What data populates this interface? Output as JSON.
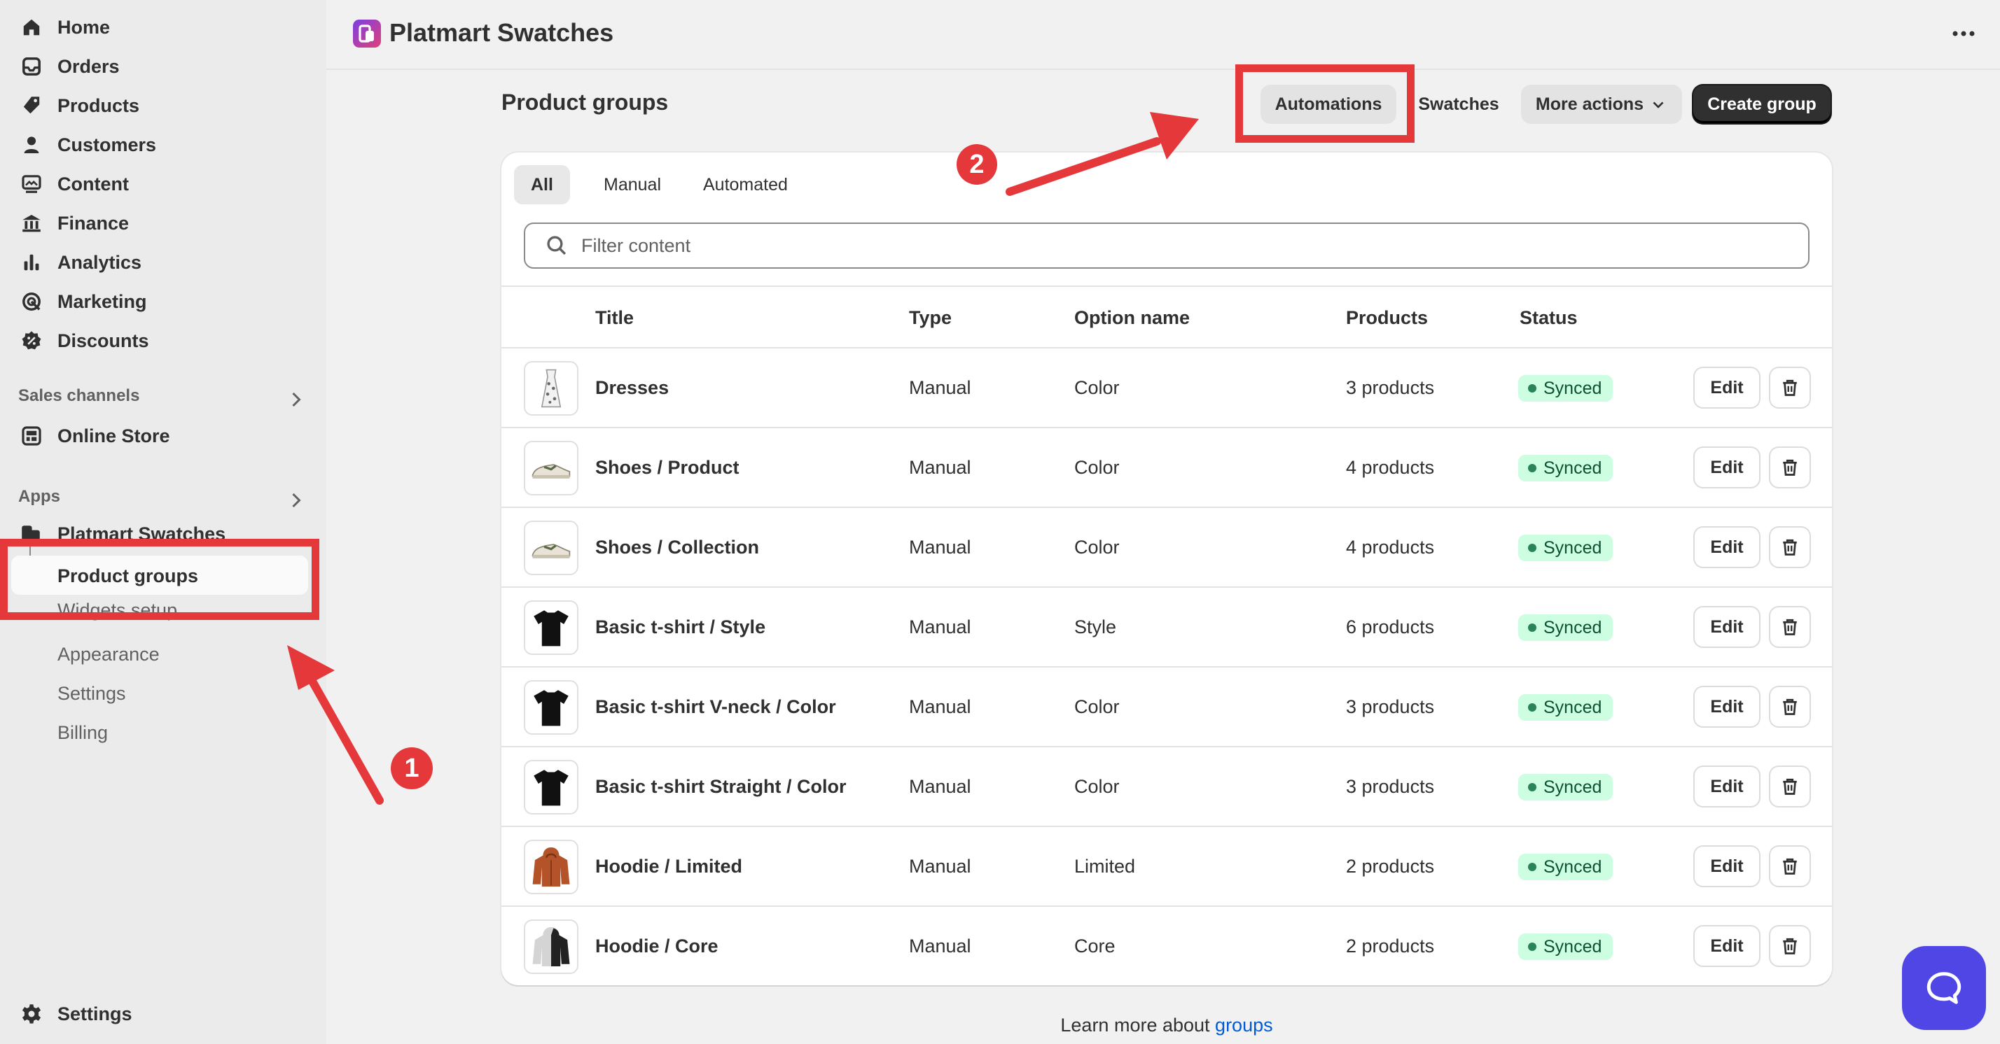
{
  "sidebar": {
    "nav": [
      {
        "label": "Home",
        "icon": "home-icon"
      },
      {
        "label": "Orders",
        "icon": "inbox-icon"
      },
      {
        "label": "Products",
        "icon": "tag-icon"
      },
      {
        "label": "Customers",
        "icon": "person-icon"
      },
      {
        "label": "Content",
        "icon": "image-icon"
      },
      {
        "label": "Finance",
        "icon": "bank-icon"
      },
      {
        "label": "Analytics",
        "icon": "bar-chart-icon"
      },
      {
        "label": "Marketing",
        "icon": "target-icon"
      },
      {
        "label": "Discounts",
        "icon": "discount-icon"
      }
    ],
    "sales_channels_label": "Sales channels",
    "online_store_label": "Online Store",
    "apps_label": "Apps",
    "app_name": "Platmart Swatches",
    "app_subitems": {
      "active": "Product groups",
      "widgets": "Widgets setup",
      "appearance": "Appearance",
      "settings": "Settings",
      "billing": "Billing"
    },
    "settings_label": "Settings"
  },
  "header": {
    "app_title": "Platmart Swatches"
  },
  "page": {
    "title": "Product groups",
    "actions": {
      "automations": "Automations",
      "swatches": "Swatches",
      "more_actions": "More actions",
      "create_group": "Create group"
    },
    "tabs": [
      "All",
      "Manual",
      "Automated"
    ],
    "filter_placeholder": "Filter content",
    "columns": {
      "title": "Title",
      "type": "Type",
      "option_name": "Option name",
      "products": "Products",
      "status": "Status"
    },
    "rows": [
      {
        "title": "Dresses",
        "type": "Manual",
        "option": "Color",
        "products": "3 products",
        "status": "Synced",
        "thumb": "dress"
      },
      {
        "title": "Shoes / Product",
        "type": "Manual",
        "option": "Color",
        "products": "4 products",
        "status": "Synced",
        "thumb": "shoe"
      },
      {
        "title": "Shoes / Collection",
        "type": "Manual",
        "option": "Color",
        "products": "4 products",
        "status": "Synced",
        "thumb": "shoe"
      },
      {
        "title": "Basic t-shirt / Style",
        "type": "Manual",
        "option": "Style",
        "products": "6 products",
        "status": "Synced",
        "thumb": "tshirt"
      },
      {
        "title": "Basic t-shirt V-neck / Color",
        "type": "Manual",
        "option": "Color",
        "products": "3 products",
        "status": "Synced",
        "thumb": "tshirt"
      },
      {
        "title": "Basic t-shirt Straight / Color",
        "type": "Manual",
        "option": "Color",
        "products": "3 products",
        "status": "Synced",
        "thumb": "tshirt"
      },
      {
        "title": "Hoodie / Limited",
        "type": "Manual",
        "option": "Limited",
        "products": "2 products",
        "status": "Synced",
        "thumb": "hoodie-orange"
      },
      {
        "title": "Hoodie / Core",
        "type": "Manual",
        "option": "Core",
        "products": "2 products",
        "status": "Synced",
        "thumb": "hoodie-grey"
      }
    ],
    "edit_label": "Edit",
    "footer_prefix": "Learn more about",
    "footer_link": "groups"
  },
  "annotations": {
    "step1": "1",
    "step2": "2",
    "color": "#e5383b"
  }
}
